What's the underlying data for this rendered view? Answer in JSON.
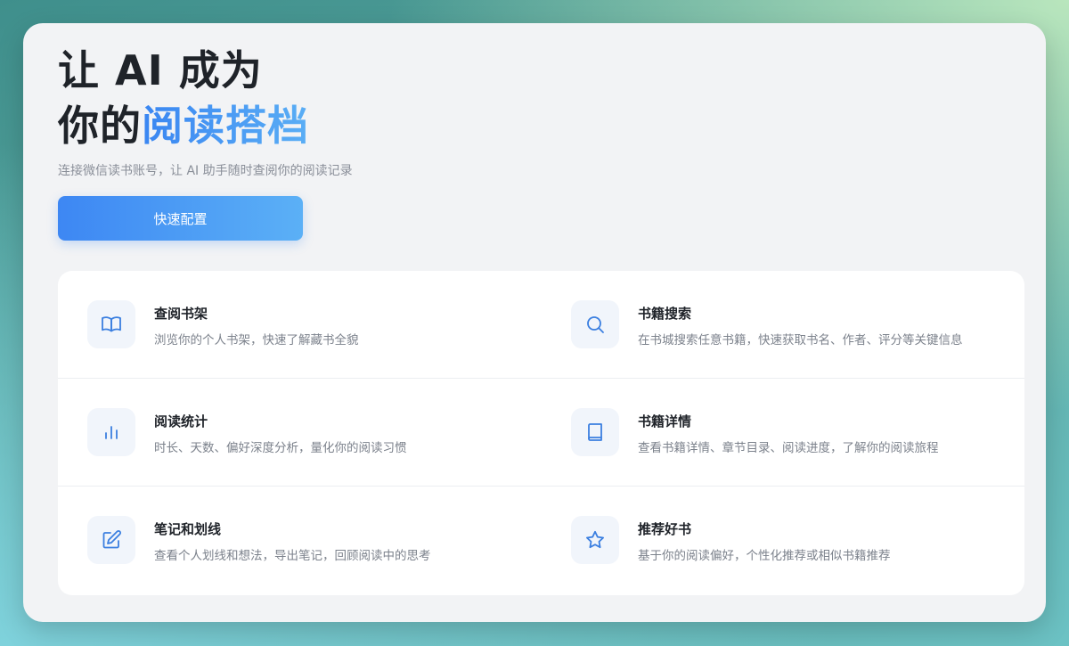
{
  "hero": {
    "title_line1": "让 AI 成为",
    "title_line2_prefix": "你的",
    "title_line2_highlight": "阅读搭档",
    "subtitle": "连接微信读书账号，让 AI 助手随时查阅你的阅读记录",
    "cta_label": "快速配置"
  },
  "features": [
    {
      "icon": "book-open-icon",
      "title": "查阅书架",
      "desc": "浏览你的个人书架，快速了解藏书全貌"
    },
    {
      "icon": "search-icon",
      "title": "书籍搜索",
      "desc": "在书城搜索任意书籍，快速获取书名、作者、评分等关键信息"
    },
    {
      "icon": "bar-chart-icon",
      "title": "阅读统计",
      "desc": "时长、天数、偏好深度分析，量化你的阅读习惯"
    },
    {
      "icon": "book-icon",
      "title": "书籍详情",
      "desc": "查看书籍详情、章节目录、阅读进度，了解你的阅读旅程"
    },
    {
      "icon": "edit-icon",
      "title": "笔记和划线",
      "desc": "查看个人划线和想法，导出笔记，回顾阅读中的思考"
    },
    {
      "icon": "star-icon",
      "title": "推荐好书",
      "desc": "基于你的阅读偏好，个性化推荐或相似书籍推荐"
    }
  ],
  "colors": {
    "accent": "#3d87f3",
    "accent_light": "#5bb0f6",
    "icon_stroke": "#3b7fe0",
    "icon_bg": "#f1f5fb"
  }
}
